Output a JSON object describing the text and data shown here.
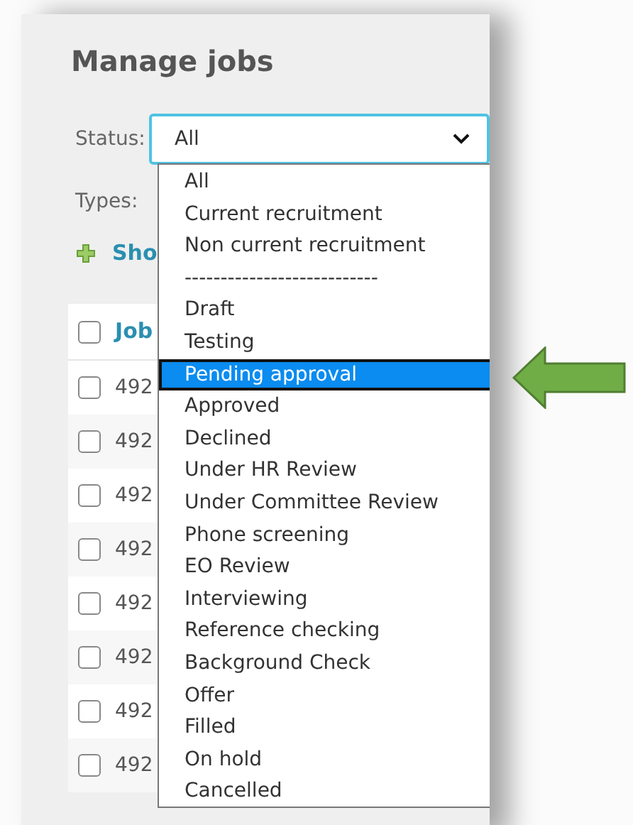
{
  "title": "Manage jobs",
  "filters": [
    {
      "label": "Status:",
      "value": "All"
    },
    {
      "label": "Types:"
    }
  ],
  "show_link": "Sho",
  "table": {
    "header": {
      "checked": false,
      "label": "Job"
    },
    "rows": [
      {
        "checked": false,
        "id": "492"
      },
      {
        "checked": false,
        "id": "492"
      },
      {
        "checked": false,
        "id": "492"
      },
      {
        "checked": false,
        "id": "492"
      },
      {
        "checked": false,
        "id": "492"
      },
      {
        "checked": false,
        "id": "492"
      },
      {
        "checked": false,
        "id": "492"
      },
      {
        "checked": false,
        "id": "492"
      }
    ]
  },
  "dropdown": {
    "options": [
      {
        "label": "All",
        "selected": false
      },
      {
        "label": "Current recruitment",
        "selected": false
      },
      {
        "label": "Non current recruitment",
        "selected": false
      },
      {
        "label": "---------------------------",
        "selected": false
      },
      {
        "label": "Draft",
        "selected": false
      },
      {
        "label": "Testing",
        "selected": false
      },
      {
        "label": "Pending approval",
        "selected": true
      },
      {
        "label": "Approved",
        "selected": false
      },
      {
        "label": "Declined",
        "selected": false
      },
      {
        "label": "Under HR Review",
        "selected": false
      },
      {
        "label": "Under Committee Review",
        "selected": false
      },
      {
        "label": "Phone screening",
        "selected": false
      },
      {
        "label": "EO Review",
        "selected": false
      },
      {
        "label": "Interviewing",
        "selected": false
      },
      {
        "label": "Reference checking",
        "selected": false
      },
      {
        "label": "Background Check",
        "selected": false
      },
      {
        "label": "Offer",
        "selected": false
      },
      {
        "label": "Filled",
        "selected": false
      },
      {
        "label": "On hold",
        "selected": false
      },
      {
        "label": "Cancelled",
        "selected": false
      }
    ]
  }
}
